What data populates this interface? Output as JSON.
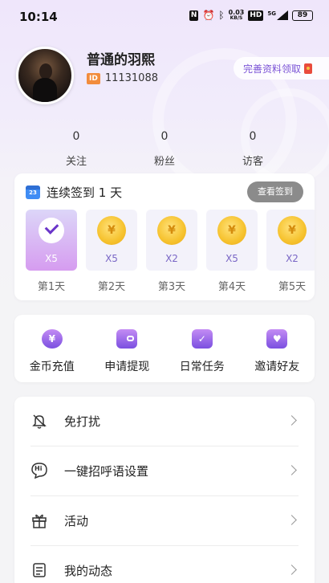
{
  "status_bar": {
    "time": "10:14",
    "nfc": "N",
    "speed_value": "0.03",
    "speed_unit": "KB/S",
    "hd": "HD",
    "network": "5G",
    "battery": "89"
  },
  "profile": {
    "nickname": "普通的羽熙",
    "id_tag": "ID",
    "id_value": "11131088",
    "complete_label": "完善资料领取"
  },
  "stats": [
    {
      "value": "0",
      "label": "关注"
    },
    {
      "value": "0",
      "label": "粉丝"
    },
    {
      "value": "0",
      "label": "访客"
    }
  ],
  "signin": {
    "calendar_number": "23",
    "title": "连续签到 1 天",
    "view_button": "查看签到",
    "days": [
      {
        "label": "第1天",
        "multiplier": "X5",
        "coin": "",
        "checked": true
      },
      {
        "label": "第2天",
        "multiplier": "X5",
        "coin": "¥",
        "checked": false
      },
      {
        "label": "第3天",
        "multiplier": "X2",
        "coin": "¥",
        "checked": false
      },
      {
        "label": "第4天",
        "multiplier": "X5",
        "coin": "¥",
        "checked": false
      },
      {
        "label": "第5天",
        "multiplier": "X2",
        "coin": "¥",
        "checked": false
      }
    ]
  },
  "actions": [
    {
      "label": "金币充值",
      "icon": "yen-coin-icon",
      "glyph": "¥"
    },
    {
      "label": "申请提现",
      "icon": "wallet-icon",
      "glyph": ""
    },
    {
      "label": "日常任务",
      "icon": "clipboard-check-icon",
      "glyph": "✓"
    },
    {
      "label": "邀请好友",
      "icon": "heart-mail-icon",
      "glyph": "♥"
    }
  ],
  "menu": [
    {
      "label": "免打扰",
      "icon": "bell-off-icon",
      "glyph": "🔕"
    },
    {
      "label": "一键招呼语设置",
      "icon": "hi-chat-icon",
      "glyph": "Hi"
    },
    {
      "label": "活动",
      "icon": "gift-icon",
      "glyph": "🎁"
    },
    {
      "label": "我的动态",
      "icon": "document-icon",
      "glyph": "≣"
    }
  ],
  "colors": {
    "accent": "#7b53d6",
    "coin": "#f6c22e",
    "view_button": "#8b8b8b"
  }
}
